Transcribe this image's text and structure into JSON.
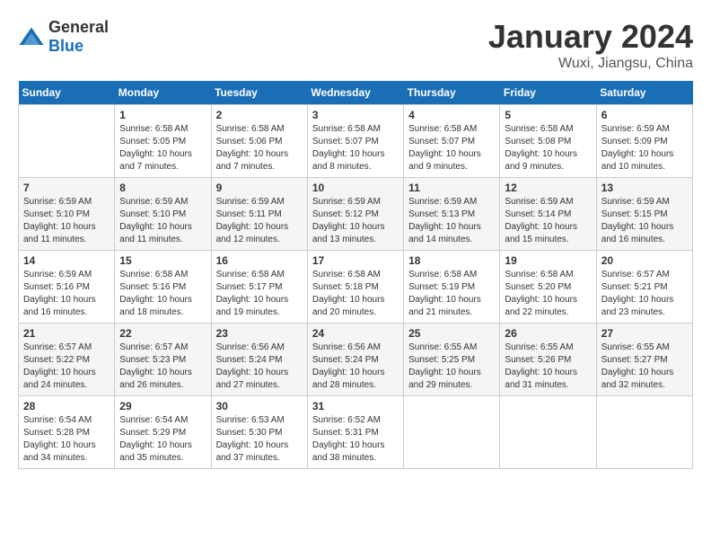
{
  "header": {
    "logo_general": "General",
    "logo_blue": "Blue",
    "month": "January 2024",
    "location": "Wuxi, Jiangsu, China"
  },
  "columns": [
    "Sunday",
    "Monday",
    "Tuesday",
    "Wednesday",
    "Thursday",
    "Friday",
    "Saturday"
  ],
  "weeks": [
    [
      {
        "day": "",
        "sunrise": "",
        "sunset": "",
        "daylight": ""
      },
      {
        "day": "1",
        "sunrise": "6:58 AM",
        "sunset": "5:05 PM",
        "daylight": "10 hours and 7 minutes."
      },
      {
        "day": "2",
        "sunrise": "6:58 AM",
        "sunset": "5:06 PM",
        "daylight": "10 hours and 7 minutes."
      },
      {
        "day": "3",
        "sunrise": "6:58 AM",
        "sunset": "5:07 PM",
        "daylight": "10 hours and 8 minutes."
      },
      {
        "day": "4",
        "sunrise": "6:58 AM",
        "sunset": "5:07 PM",
        "daylight": "10 hours and 9 minutes."
      },
      {
        "day": "5",
        "sunrise": "6:58 AM",
        "sunset": "5:08 PM",
        "daylight": "10 hours and 9 minutes."
      },
      {
        "day": "6",
        "sunrise": "6:59 AM",
        "sunset": "5:09 PM",
        "daylight": "10 hours and 10 minutes."
      }
    ],
    [
      {
        "day": "7",
        "sunrise": "6:59 AM",
        "sunset": "5:10 PM",
        "daylight": "10 hours and 11 minutes."
      },
      {
        "day": "8",
        "sunrise": "6:59 AM",
        "sunset": "5:10 PM",
        "daylight": "10 hours and 11 minutes."
      },
      {
        "day": "9",
        "sunrise": "6:59 AM",
        "sunset": "5:11 PM",
        "daylight": "10 hours and 12 minutes."
      },
      {
        "day": "10",
        "sunrise": "6:59 AM",
        "sunset": "5:12 PM",
        "daylight": "10 hours and 13 minutes."
      },
      {
        "day": "11",
        "sunrise": "6:59 AM",
        "sunset": "5:13 PM",
        "daylight": "10 hours and 14 minutes."
      },
      {
        "day": "12",
        "sunrise": "6:59 AM",
        "sunset": "5:14 PM",
        "daylight": "10 hours and 15 minutes."
      },
      {
        "day": "13",
        "sunrise": "6:59 AM",
        "sunset": "5:15 PM",
        "daylight": "10 hours and 16 minutes."
      }
    ],
    [
      {
        "day": "14",
        "sunrise": "6:59 AM",
        "sunset": "5:16 PM",
        "daylight": "10 hours and 16 minutes."
      },
      {
        "day": "15",
        "sunrise": "6:58 AM",
        "sunset": "5:16 PM",
        "daylight": "10 hours and 18 minutes."
      },
      {
        "day": "16",
        "sunrise": "6:58 AM",
        "sunset": "5:17 PM",
        "daylight": "10 hours and 19 minutes."
      },
      {
        "day": "17",
        "sunrise": "6:58 AM",
        "sunset": "5:18 PM",
        "daylight": "10 hours and 20 minutes."
      },
      {
        "day": "18",
        "sunrise": "6:58 AM",
        "sunset": "5:19 PM",
        "daylight": "10 hours and 21 minutes."
      },
      {
        "day": "19",
        "sunrise": "6:58 AM",
        "sunset": "5:20 PM",
        "daylight": "10 hours and 22 minutes."
      },
      {
        "day": "20",
        "sunrise": "6:57 AM",
        "sunset": "5:21 PM",
        "daylight": "10 hours and 23 minutes."
      }
    ],
    [
      {
        "day": "21",
        "sunrise": "6:57 AM",
        "sunset": "5:22 PM",
        "daylight": "10 hours and 24 minutes."
      },
      {
        "day": "22",
        "sunrise": "6:57 AM",
        "sunset": "5:23 PM",
        "daylight": "10 hours and 26 minutes."
      },
      {
        "day": "23",
        "sunrise": "6:56 AM",
        "sunset": "5:24 PM",
        "daylight": "10 hours and 27 minutes."
      },
      {
        "day": "24",
        "sunrise": "6:56 AM",
        "sunset": "5:24 PM",
        "daylight": "10 hours and 28 minutes."
      },
      {
        "day": "25",
        "sunrise": "6:55 AM",
        "sunset": "5:25 PM",
        "daylight": "10 hours and 29 minutes."
      },
      {
        "day": "26",
        "sunrise": "6:55 AM",
        "sunset": "5:26 PM",
        "daylight": "10 hours and 31 minutes."
      },
      {
        "day": "27",
        "sunrise": "6:55 AM",
        "sunset": "5:27 PM",
        "daylight": "10 hours and 32 minutes."
      }
    ],
    [
      {
        "day": "28",
        "sunrise": "6:54 AM",
        "sunset": "5:28 PM",
        "daylight": "10 hours and 34 minutes."
      },
      {
        "day": "29",
        "sunrise": "6:54 AM",
        "sunset": "5:29 PM",
        "daylight": "10 hours and 35 minutes."
      },
      {
        "day": "30",
        "sunrise": "6:53 AM",
        "sunset": "5:30 PM",
        "daylight": "10 hours and 37 minutes."
      },
      {
        "day": "31",
        "sunrise": "6:52 AM",
        "sunset": "5:31 PM",
        "daylight": "10 hours and 38 minutes."
      },
      {
        "day": "",
        "sunrise": "",
        "sunset": "",
        "daylight": ""
      },
      {
        "day": "",
        "sunrise": "",
        "sunset": "",
        "daylight": ""
      },
      {
        "day": "",
        "sunrise": "",
        "sunset": "",
        "daylight": ""
      }
    ]
  ]
}
